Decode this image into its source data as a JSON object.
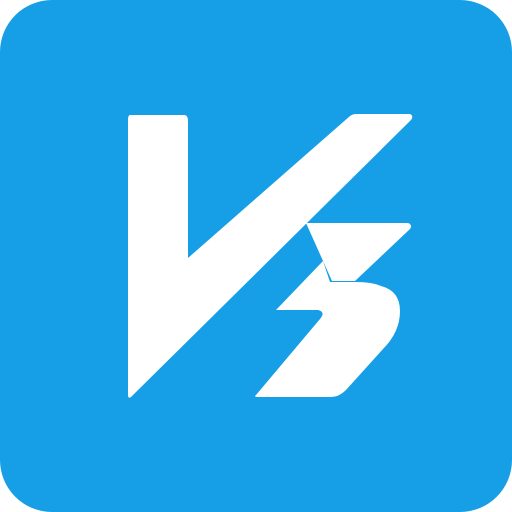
{
  "app_icon": {
    "icon_name": "v3-logo-icon",
    "background_color": "#169FE6",
    "glyph_color": "#FFFFFF",
    "logo_lettering": "V3"
  }
}
